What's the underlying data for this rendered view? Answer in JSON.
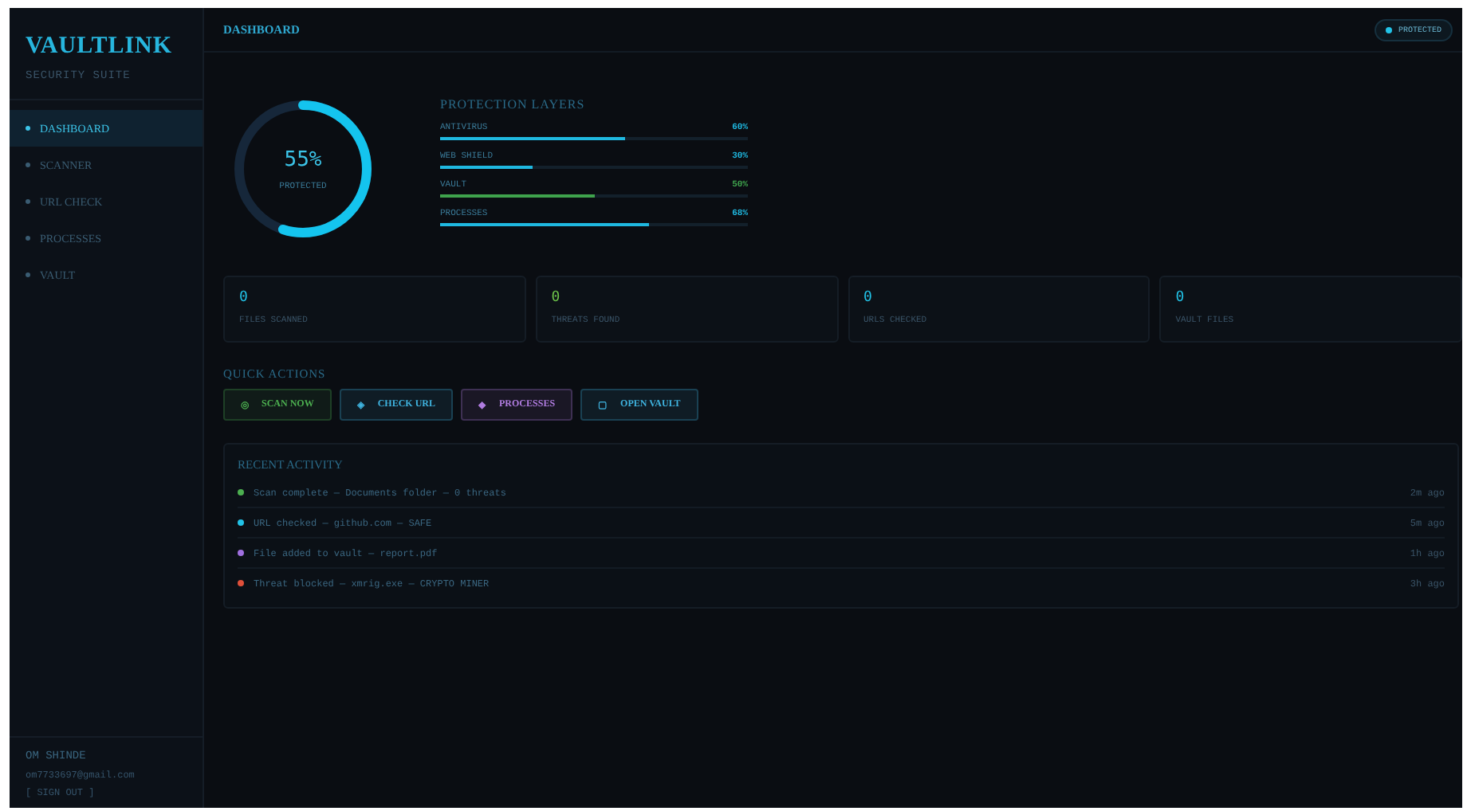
{
  "sidebar": {
    "logo": "VAULTLINK",
    "subtitle": "SECURITY SUITE",
    "items": [
      {
        "label": "DASHBOARD",
        "selected": true
      },
      {
        "label": "SCANNER",
        "selected": false
      },
      {
        "label": "URL CHECK",
        "selected": false
      },
      {
        "label": "PROCESSES",
        "selected": false
      },
      {
        "label": "VAULT",
        "selected": false
      }
    ],
    "user": {
      "name": "OM SHINDE",
      "email": "om7733697@gmail.com",
      "sign_out": "[ SIGN OUT ]"
    }
  },
  "header": {
    "title": "DASHBOARD",
    "status": "PROTECTED"
  },
  "gauge": {
    "value": "55%",
    "label": "PROTECTED"
  },
  "layers": {
    "title": "PROTECTION LAYERS",
    "items": [
      {
        "name": "ANTIVIRUS",
        "reading": "60%",
        "level": 0.6,
        "color": "#1fb8e0"
      },
      {
        "name": "WEB SHIELD",
        "reading": "30%",
        "level": 0.3,
        "color": "#1fb8e0"
      },
      {
        "name": "VAULT",
        "reading": "50%",
        "level": 0.5,
        "color": "#3fa34d"
      },
      {
        "name": "PROCESSES",
        "reading": "68%",
        "level": 0.68,
        "color": "#1fb8e0"
      }
    ]
  },
  "stats": [
    {
      "value": "0",
      "label": "FILES SCANNED",
      "color": "#22c3e8"
    },
    {
      "value": "0",
      "label": "THREATS FOUND",
      "color": "#6cc24a"
    },
    {
      "value": "0",
      "label": "URLS CHECKED",
      "color": "#22c3e8"
    },
    {
      "value": "0",
      "label": "VAULT FILES",
      "color": "#22c3e8"
    }
  ],
  "quick_actions": {
    "title": "QUICK ACTIONS",
    "buttons": [
      {
        "icon": "◎",
        "label": "SCAN NOW",
        "color": "#4caf50"
      },
      {
        "icon": "◈",
        "label": "CHECK URL",
        "color": "#3fb4e0"
      },
      {
        "icon": "◆",
        "label": "PROCESSES",
        "color": "#b07ce0"
      },
      {
        "icon": "▢",
        "label": "OPEN VAULT",
        "color": "#3fb4e0"
      }
    ]
  },
  "recent_activity": {
    "title": "RECENT ACTIVITY",
    "items": [
      {
        "text": "Scan complete — Documents folder — 0 threats",
        "time": "2m ago",
        "color": "#4caf50"
      },
      {
        "text": "URL checked — github.com — SAFE",
        "time": "5m ago",
        "color": "#22c3e8"
      },
      {
        "text": "File added to vault — report.pdf",
        "time": "1h ago",
        "color": "#a070e0"
      },
      {
        "text": "Threat blocked — xmrig.exe — CRYPTO MINER",
        "time": "3h ago",
        "color": "#e0503a"
      }
    ]
  }
}
